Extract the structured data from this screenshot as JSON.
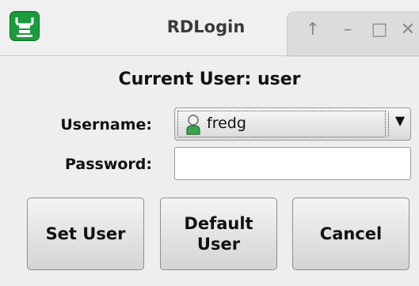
{
  "window": {
    "title": "RDLogin",
    "controls": {
      "up_glyph": "↑",
      "minimize_glyph": "–",
      "maximize_glyph": "□",
      "close_glyph": "✕"
    }
  },
  "main": {
    "current_user": "Current User: user",
    "username_label": "Username:",
    "username_selected": "fredg",
    "password_label": "Password:",
    "password_value": ""
  },
  "buttons": {
    "set_user": "Set User",
    "default_user": "Default\nUser",
    "cancel": "Cancel"
  },
  "icons": {
    "app": "rdlogin-app-icon",
    "user": "user-icon",
    "dropdown": "dropdown-arrow-icon"
  },
  "colors": {
    "accent_green": "#1c9b3c",
    "window_bg": "#eeeeee"
  }
}
